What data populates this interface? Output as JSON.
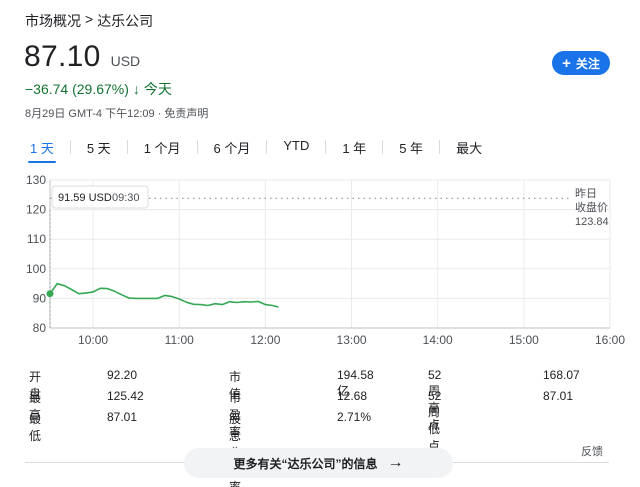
{
  "breadcrumb": {
    "parent": "市场概况",
    "separator": ">",
    "current": "达乐公司"
  },
  "quote": {
    "price": "87.10",
    "currency": "USD",
    "change": "−36.74 (29.67%)",
    "change_direction_icon": "arrow-down-icon",
    "period": "今天",
    "meta": "8月29日 GMT-4 下午12:09 · 免责声明"
  },
  "follow_button": {
    "icon": "plus-icon",
    "label": "关注"
  },
  "tabs": [
    "1 天",
    "5 天",
    "1 个月",
    "6 个月",
    "YTD",
    "1 年",
    "5 年",
    "最大"
  ],
  "active_tab": "1 天",
  "tooltip": {
    "price": "91.59 USD",
    "time": "09:30"
  },
  "prev_close": {
    "label1": "昨日",
    "label2": "收盘价",
    "value": "123.84"
  },
  "chart_data": {
    "type": "line",
    "y_ticks": [
      "130",
      "120",
      "110",
      "100",
      "90",
      "80"
    ],
    "x_ticks": [
      "10:00",
      "11:00",
      "12:00",
      "13:00",
      "14:00",
      "15:00",
      "16:00"
    ],
    "ylim": [
      80,
      130
    ],
    "xlim": [
      "09:30",
      "16:00"
    ],
    "previous_close": 123.84,
    "series": [
      {
        "x": [
          "09:30",
          "09:35",
          "09:40",
          "09:45",
          "09:50",
          "09:55",
          "10:00",
          "10:05",
          "10:10",
          "10:15",
          "10:20",
          "10:25",
          "10:30",
          "10:35",
          "10:40",
          "10:45",
          "10:50",
          "10:55",
          "11:00",
          "11:05",
          "11:10",
          "11:15",
          "11:20",
          "11:25",
          "11:30",
          "11:35",
          "11:40",
          "11:45",
          "11:50",
          "11:55",
          "12:00",
          "12:05",
          "12:09"
        ],
        "y": [
          91.59,
          95.0,
          94.3,
          93.0,
          91.6,
          91.8,
          92.2,
          93.4,
          93.3,
          92.4,
          91.2,
          90.1,
          90.0,
          90.0,
          90.0,
          90.0,
          91.0,
          90.6,
          89.8,
          88.7,
          88.0,
          87.9,
          87.6,
          88.2,
          87.9,
          88.9,
          88.6,
          88.9,
          88.8,
          89.0,
          87.9,
          87.6,
          87.1
        ]
      }
    ],
    "line_color": "#34a853",
    "grid": true
  },
  "stats": [
    {
      "label": "开盘",
      "value": "92.20"
    },
    {
      "label": "最高",
      "value": "125.42"
    },
    {
      "label": "最低",
      "value": "87.01"
    },
    {
      "label": "市值",
      "value": "194.58亿"
    },
    {
      "label": "市盈率",
      "value": "12.68"
    },
    {
      "label": "股息收益率",
      "value": "2.71%"
    },
    {
      "label": "52 周高点",
      "value": "168.07"
    },
    {
      "label": "52 周低点",
      "value": "87.01"
    }
  ],
  "feedback": "反馈",
  "more_button": {
    "label": "更多有关“达乐公司”的信息",
    "icon": "arrow-right-icon"
  },
  "colors": {
    "accent": "#1a73e8",
    "positive_line": "#34a853",
    "change_text": "#137333"
  }
}
